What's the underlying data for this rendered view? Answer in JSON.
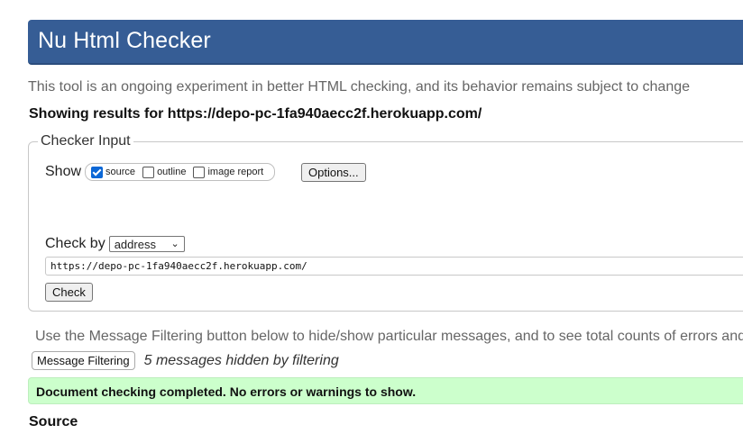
{
  "header": {
    "title": "Nu Html Checker"
  },
  "intro": "This tool is an ongoing experiment in better HTML checking, and its behavior remains subject to change",
  "results": "Showing results for https://depo-pc-1fa940aecc2f.herokuapp.com/",
  "checker_input": {
    "legend": "Checker Input",
    "show_label": "Show",
    "options": [
      {
        "label": "source",
        "checked": true
      },
      {
        "label": "outline",
        "checked": false
      },
      {
        "label": "image report",
        "checked": false
      }
    ],
    "options_button": "Options...",
    "check_by_label": "Check by",
    "check_by_value": "address",
    "url_value": "https://depo-pc-1fa940aecc2f.herokuapp.com/",
    "check_button": "Check"
  },
  "filter": {
    "info": "Use the Message Filtering button below to hide/show particular messages, and to see total counts of errors and",
    "button": "Message Filtering",
    "hidden_count": "5 messages hidden by filtering"
  },
  "status": "Document checking completed. No errors or warnings to show.",
  "source_heading": "Source",
  "colors": {
    "header": "#365d95",
    "success": "#ccffcc",
    "checkbox": "#0b67d6"
  }
}
